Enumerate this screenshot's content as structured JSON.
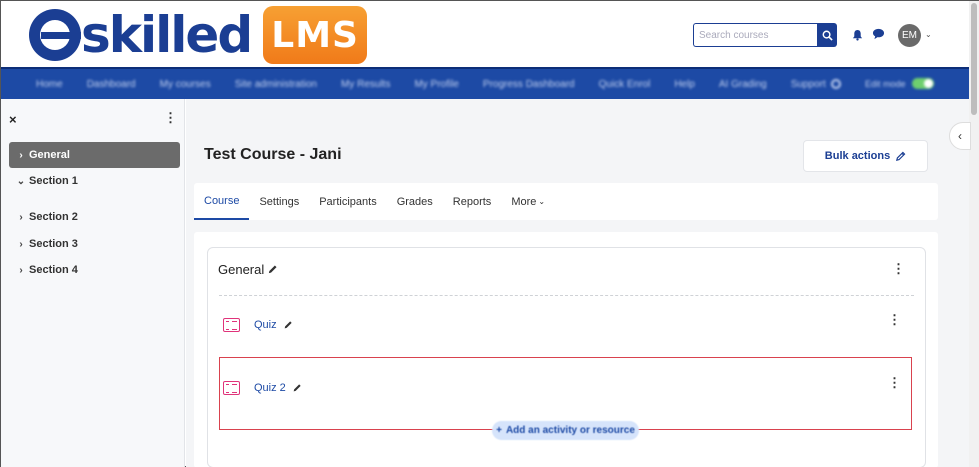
{
  "brand": {
    "name": "skilled",
    "badge": "LMS"
  },
  "header": {
    "search_placeholder": "Search courses",
    "avatar_initials": "EM",
    "avatar_caret": "⌄"
  },
  "navbar": {
    "items": [
      "Home",
      "Dashboard",
      "My courses",
      "Site administration",
      "My Results",
      "My Profile",
      "Progress Dashboard",
      "Quick Enrol",
      "Help",
      "AI Grading",
      "Support"
    ],
    "edit_mode_label": "Edit mode"
  },
  "drawer": {
    "close": "×",
    "more": "⋮",
    "sections": [
      {
        "label": "General",
        "chevron": "›",
        "active": true
      },
      {
        "label": "Section 1",
        "chevron": "⌄",
        "active": false
      },
      {
        "label": "Section 2",
        "chevron": "›",
        "active": false
      },
      {
        "label": "Section 3",
        "chevron": "›",
        "active": false
      },
      {
        "label": "Section 4",
        "chevron": "›",
        "active": false
      }
    ]
  },
  "course": {
    "title": "Test Course - Jani",
    "bulk_actions": "Bulk actions",
    "tabs": [
      "Course",
      "Settings",
      "Participants",
      "Grades",
      "Reports",
      "More"
    ],
    "more_caret": "⌄"
  },
  "section": {
    "name": "General",
    "activities": [
      {
        "name": "Quiz"
      },
      {
        "name": "Quiz 2"
      }
    ],
    "add_activity": "Add an activity or resource",
    "add_plus": "+"
  },
  "ui": {
    "kebab": "⋮",
    "collapse": "‹"
  },
  "colors": {
    "brand_blue": "#1b3e93",
    "nav_blue": "#1d4aa5",
    "badge_orange": "#f07a19",
    "quiz_pink": "#e0337a",
    "highlight_red": "#d9424e"
  }
}
